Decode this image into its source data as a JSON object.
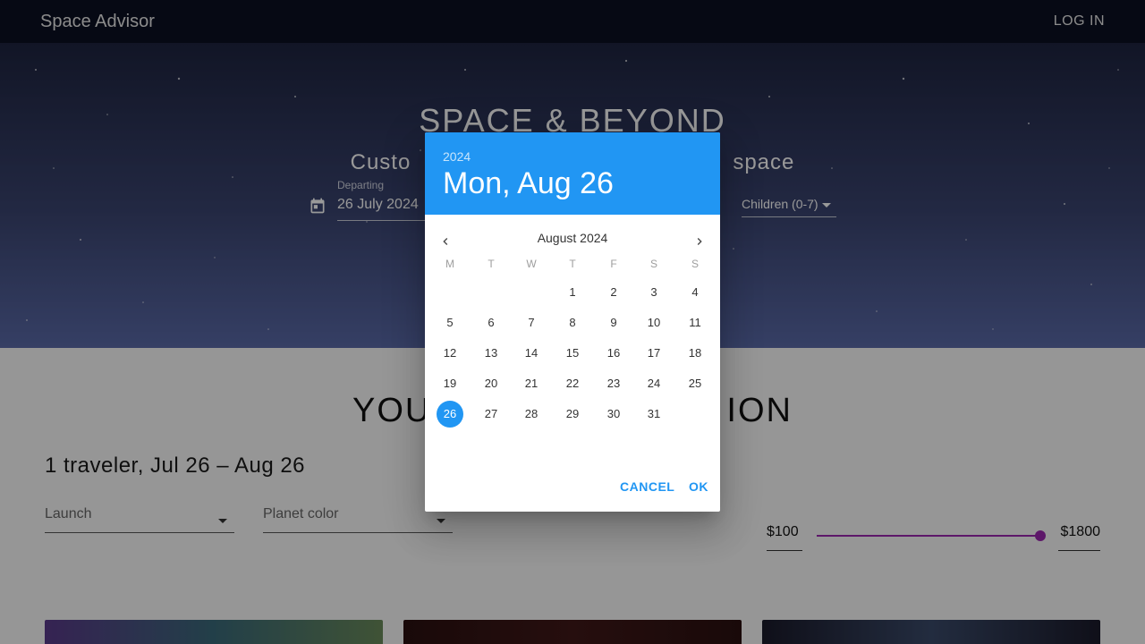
{
  "appbar": {
    "brand": "Space Advisor",
    "login_label": "LOG IN"
  },
  "hero": {
    "title": "SPACE & BEYOND",
    "subtitle_left": "Custo",
    "subtitle_right": "space",
    "departing_label": "Departing",
    "departing_value": "26 July 2024",
    "children_label": "Children (0-7)"
  },
  "results": {
    "title_left": "YOU",
    "title_right": "ION",
    "summary": "1 traveler, Jul 26 – Aug 26",
    "launch_label": "Launch",
    "planet_color_label": "Planet color",
    "price_min": "$100",
    "price_max": "$1800",
    "price_slider_value": 1800
  },
  "datepicker": {
    "year": "2024",
    "selected_date": "Mon, Aug 26",
    "month_label": "August 2024",
    "weekdays": [
      "M",
      "T",
      "W",
      "T",
      "F",
      "S",
      "S"
    ],
    "days": [
      "1",
      "2",
      "3",
      "4",
      "5",
      "6",
      "7",
      "8",
      "9",
      "10",
      "11",
      "12",
      "13",
      "14",
      "15",
      "16",
      "17",
      "18",
      "19",
      "20",
      "21",
      "22",
      "23",
      "24",
      "25",
      "26",
      "27",
      "28",
      "29",
      "30",
      "31"
    ],
    "selected_day": "26",
    "cancel_label": "CANCEL",
    "ok_label": "OK"
  },
  "colors": {
    "accent": "#2196f3",
    "slider": "#9c27b0",
    "appbar": "#0a1022"
  }
}
